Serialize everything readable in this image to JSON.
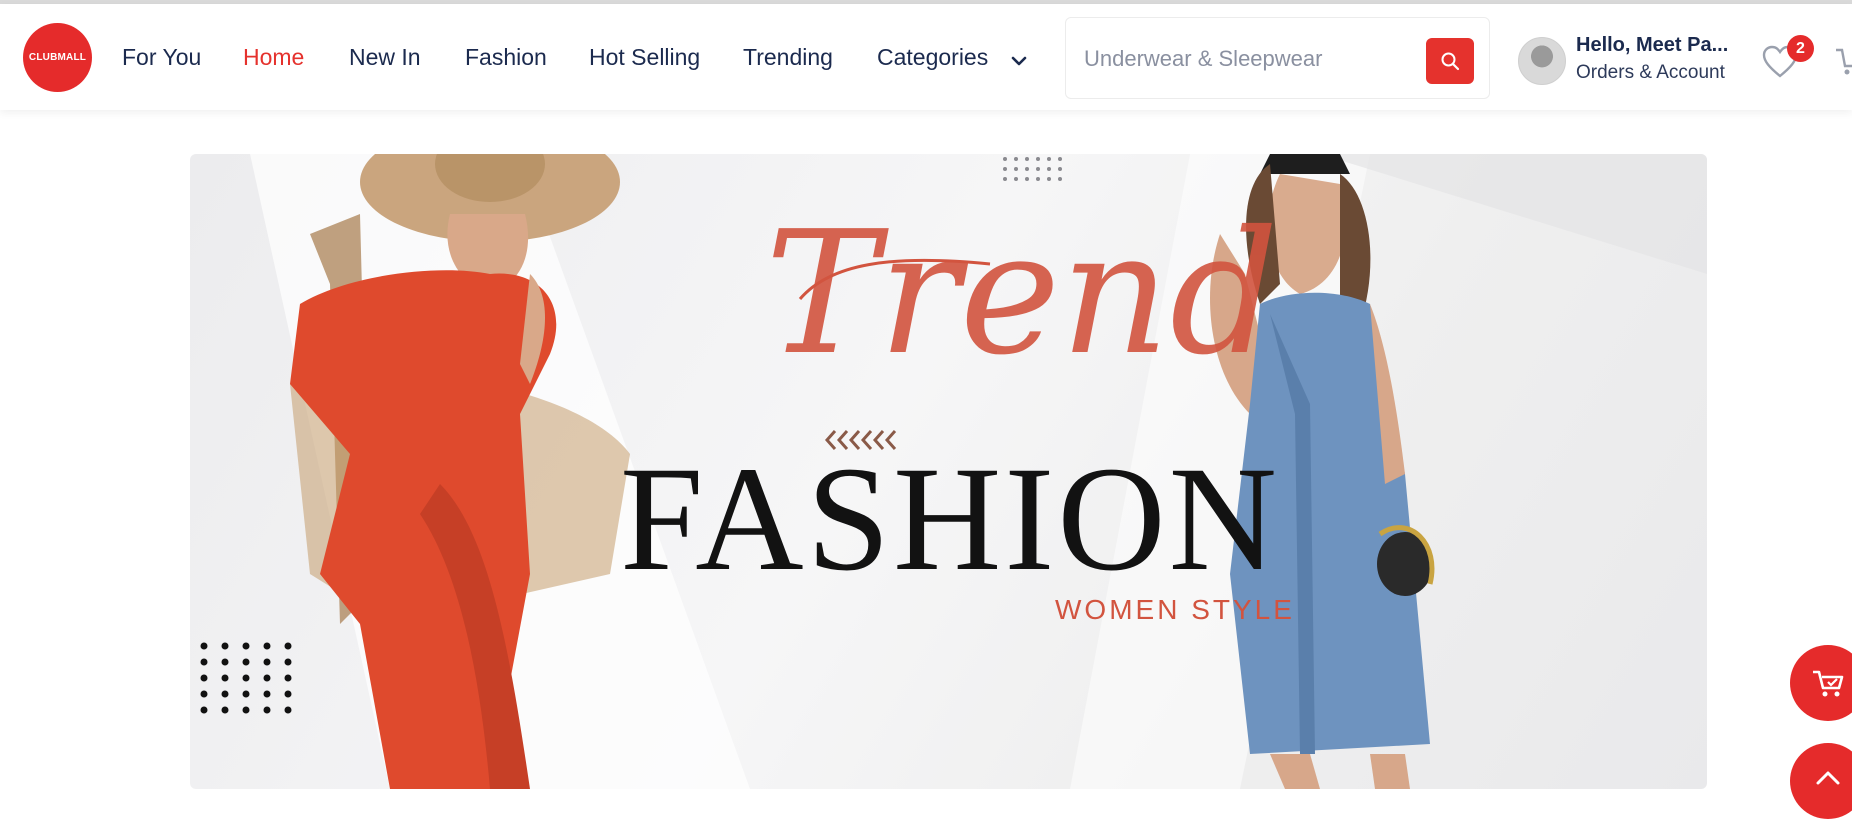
{
  "brand": {
    "logo_text": "CLUBMALL",
    "accent": "#e52b2b"
  },
  "nav": {
    "items": [
      {
        "label": "For You"
      },
      {
        "label": "Home",
        "active": true
      },
      {
        "label": "New In"
      },
      {
        "label": "Fashion"
      },
      {
        "label": "Hot Selling"
      },
      {
        "label": "Trending"
      },
      {
        "label": "Categories"
      }
    ],
    "categories_icon": "chevron-down-icon"
  },
  "search": {
    "placeholder": "Underwear & Sleepwear",
    "button_icon": "search-icon"
  },
  "account": {
    "greeting": "Hello, Meet Pa...",
    "subtitle": "Orders & Account"
  },
  "wishlist": {
    "count": "2",
    "icon": "heart-icon"
  },
  "banner": {
    "script_text": "Trend",
    "headline": "FASHION",
    "tagline": "WOMEN STYLE",
    "script_color": "#d2543f"
  },
  "floating": {
    "cart_icon": "cart-icon",
    "scroll_icon": "chevron-up-icon"
  }
}
